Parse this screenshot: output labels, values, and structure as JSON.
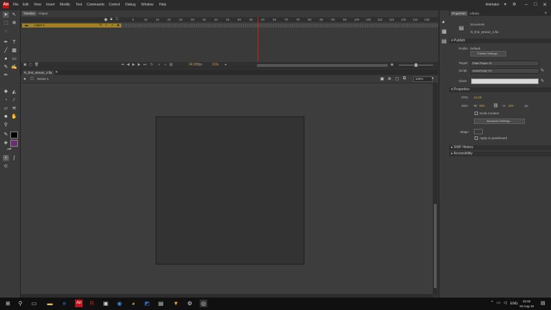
{
  "app": {
    "logo": "An",
    "workspace": "Animator"
  },
  "menu": [
    "File",
    "Edit",
    "View",
    "Insert",
    "Modify",
    "Text",
    "Commands",
    "Control",
    "Debug",
    "Window",
    "Help"
  ],
  "timeline": {
    "tabs": [
      "Timeline",
      "Output"
    ],
    "frame_numbers": [
      "5",
      "10",
      "15",
      "20",
      "25",
      "30",
      "35",
      "40",
      "45",
      "50",
      "55",
      "60",
      "65",
      "70",
      "75",
      "80",
      "85",
      "90",
      "95",
      "100",
      "105",
      "110",
      "115",
      "120",
      "125",
      "130"
    ],
    "layer_name": "Layer 1",
    "fps": "24.00",
    "fps_unit": "fps",
    "time": "0.0s"
  },
  "document": {
    "tab": "fs_first_stream_2.fla",
    "scene": "Scene 1",
    "zoom": "100%"
  },
  "properties": {
    "tabs": [
      "Properties",
      "Library"
    ],
    "doc_type": "Document",
    "file_name": "fs_first_stream_2.fla",
    "publish": {
      "header": "Publish",
      "profile_label": "Profile:",
      "profile_value": "Default",
      "settings_button": "Publish Settings...",
      "target_label": "Target:",
      "target_value": "Flash Player 22",
      "script_label": "Script:",
      "script_value": "ActionScript 3.0",
      "class_label": "Class:"
    },
    "props": {
      "header": "Properties",
      "fps_label": "FPS:",
      "fps_value": "24.00",
      "size_label": "Size:",
      "w_label": "W:",
      "w_value": "550",
      "h_label": "H:",
      "h_value": "400",
      "px": "px",
      "scale_label": "Scale Content",
      "advanced_button": "Advanced Settings...",
      "stage_label": "Stage:",
      "pasteboard_label": "Apply to pasteboard"
    },
    "swf_history": "SWF History",
    "accessibility": "Accessibility"
  },
  "taskbar": {
    "lang": "ENG",
    "time": "20:00",
    "date": "19-Aug-18"
  },
  "colors": {
    "playhead": "#cc2222",
    "layer_highlight": "#a08020",
    "value": "#d6a23a",
    "logo": "#cc0a0a"
  }
}
